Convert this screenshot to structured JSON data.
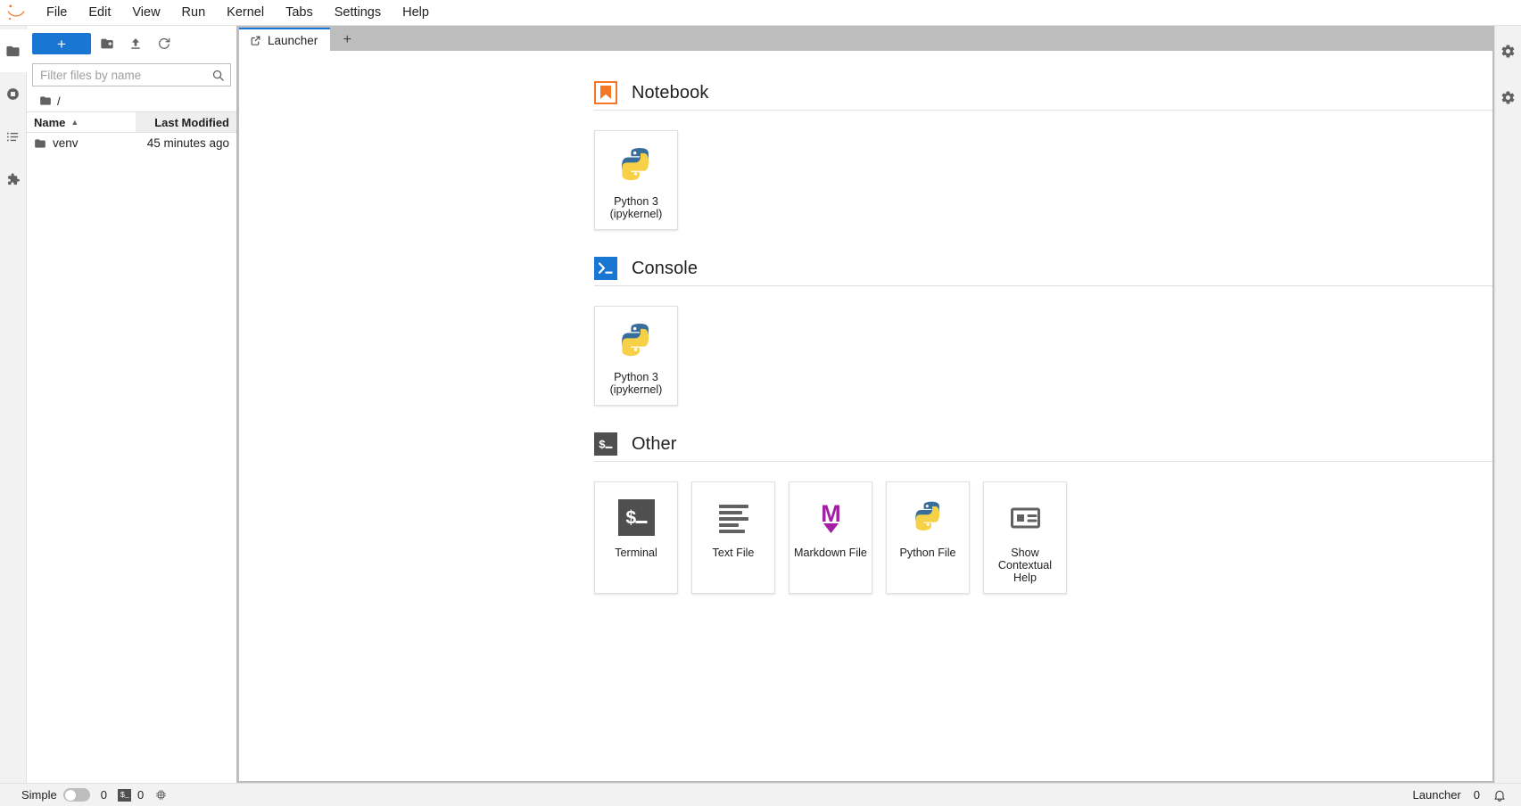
{
  "app": {
    "logo_icon": "jupyter-logo-icon",
    "menu": [
      {
        "label": "File",
        "name": "menu-file"
      },
      {
        "label": "Edit",
        "name": "menu-edit"
      },
      {
        "label": "View",
        "name": "menu-view"
      },
      {
        "label": "Run",
        "name": "menu-run"
      },
      {
        "label": "Kernel",
        "name": "menu-kernel"
      },
      {
        "label": "Tabs",
        "name": "menu-tabs"
      },
      {
        "label": "Settings",
        "name": "menu-settings"
      },
      {
        "label": "Help",
        "name": "menu-help"
      }
    ]
  },
  "left_rail": {
    "items": [
      {
        "name": "sidebar-file-browser",
        "icon": "folder-icon",
        "active": true
      },
      {
        "name": "sidebar-running-terminals-kernels",
        "icon": "running-stop-circle-icon",
        "active": false
      },
      {
        "name": "sidebar-commands",
        "icon": "command-list-icon",
        "active": false
      },
      {
        "name": "sidebar-extension-manager",
        "icon": "puzzle-piece-icon",
        "active": false
      }
    ]
  },
  "right_rail": {
    "items": [
      {
        "name": "sidebar-property-inspector",
        "icon": "gear-icon"
      },
      {
        "name": "sidebar-debugger",
        "icon": "bug-gear-icon"
      }
    ]
  },
  "file_browser": {
    "new_launcher_label": "+",
    "toolbar": [
      {
        "name": "new-folder-button",
        "icon": "new-folder-icon"
      },
      {
        "name": "upload-files-button",
        "icon": "upload-icon"
      },
      {
        "name": "refresh-file-list-button",
        "icon": "refresh-icon"
      }
    ],
    "filter_placeholder": "Filter files by name",
    "filter_value": "",
    "search_icon": "search-icon",
    "breadcrumb": {
      "root_icon": "folder-icon",
      "path": "/"
    },
    "columns": {
      "name": "Name",
      "last_modified": "Last Modified"
    },
    "sort_caret": "▲",
    "rows": [
      {
        "icon": "folder-icon",
        "name": "venv",
        "last_modified": "45 minutes ago"
      }
    ]
  },
  "tabs": {
    "items": [
      {
        "label": "Launcher",
        "icon": "launcher-tab-icon",
        "active": true,
        "name": "tab-launcher"
      }
    ],
    "add_label": "+"
  },
  "launcher": {
    "sections": [
      {
        "title": "Notebook",
        "icon": "notebook-bookmark-icon",
        "name": "launcher-section-notebook",
        "cards": [
          {
            "label": "Python 3 (ipykernel)",
            "icon": "python-logo-icon",
            "name": "launcher-card-notebook-python3"
          }
        ]
      },
      {
        "title": "Console",
        "icon": "console-prompt-icon",
        "name": "launcher-section-console",
        "cards": [
          {
            "label": "Python 3 (ipykernel)",
            "icon": "python-logo-icon",
            "name": "launcher-card-console-python3"
          }
        ]
      },
      {
        "title": "Other",
        "icon": "terminal-dollar-icon",
        "name": "launcher-section-other",
        "cards": [
          {
            "label": "Terminal",
            "icon": "terminal-dollar-icon",
            "name": "launcher-card-terminal"
          },
          {
            "label": "Text File",
            "icon": "text-file-lines-icon",
            "name": "launcher-card-text-file"
          },
          {
            "label": "Markdown File",
            "icon": "markdown-m-icon",
            "name": "launcher-card-markdown-file"
          },
          {
            "label": "Python File",
            "icon": "python-logo-icon",
            "name": "launcher-card-python-file"
          },
          {
            "label": "Show Contextual Help",
            "icon": "contextual-help-icon",
            "name": "launcher-card-contextual-help"
          }
        ]
      }
    ]
  },
  "status_bar": {
    "simple_label": "Simple",
    "simple_enabled": false,
    "kernel_count": "0",
    "terminal_icon": "terminal-dollar-icon",
    "terminal_count": "0",
    "resource_icon": "cpu-chip-icon",
    "current_tab_label": "Launcher",
    "notification_count": "0",
    "notification_icon": "bell-icon"
  },
  "colors": {
    "accent": "#1976d2",
    "notebook_orange": "#f37726",
    "console_blue": "#1976d2",
    "terminal_dark": "#4f4f4f",
    "markdown_purple": "#a31fa3",
    "python_blue": "#386e9c",
    "python_yellow": "#f6d147"
  }
}
